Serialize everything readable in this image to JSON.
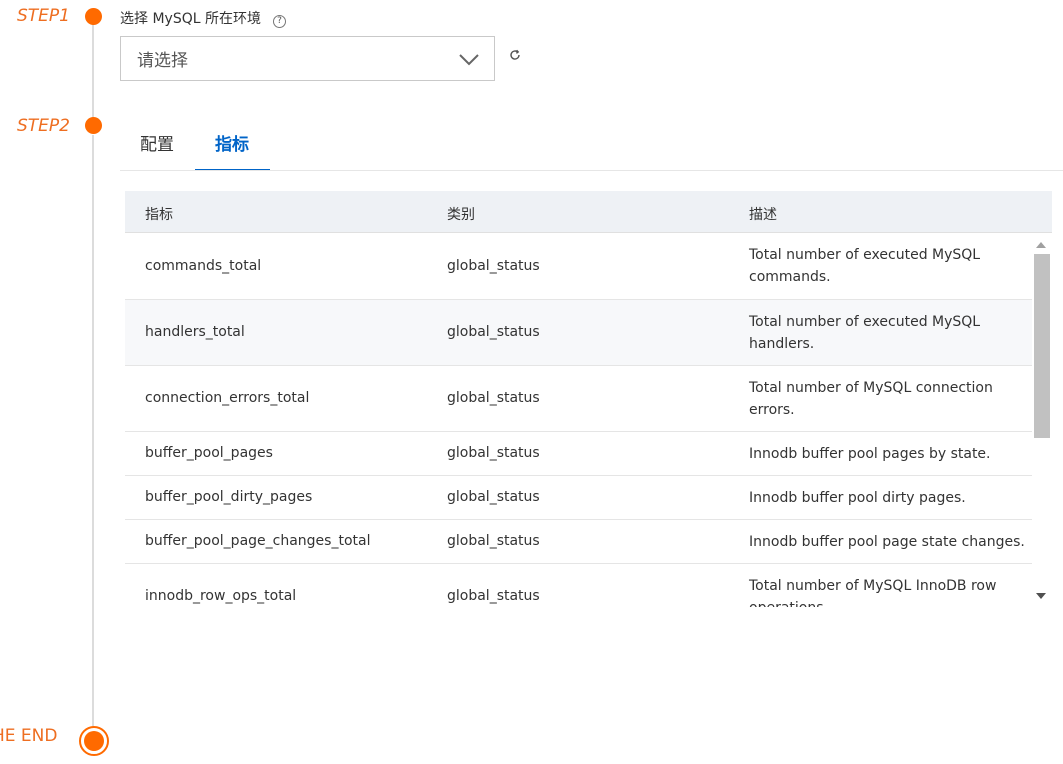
{
  "timeline": {
    "step1_label": "STEP1",
    "step2_label": "STEP2",
    "end_label": "HE END",
    "accent_color": "#ff6a00"
  },
  "step1": {
    "title": "选择 MySQL 所在环境",
    "help_icon": "?",
    "select_placeholder": "请选择"
  },
  "tabs": [
    {
      "label": "配置",
      "active": false
    },
    {
      "label": "指标",
      "active": true
    }
  ],
  "table": {
    "headers": [
      "指标",
      "类别",
      "描述"
    ],
    "rows": [
      {
        "metric": "commands_total",
        "category": "global_status",
        "description": "Total number of executed MySQL commands."
      },
      {
        "metric": "handlers_total",
        "category": "global_status",
        "description": "Total number of executed MySQL handlers."
      },
      {
        "metric": "connection_errors_total",
        "category": "global_status",
        "description": "Total number of MySQL connection errors."
      },
      {
        "metric": "buffer_pool_pages",
        "category": "global_status",
        "description": "Innodb buffer pool pages by state."
      },
      {
        "metric": "buffer_pool_dirty_pages",
        "category": "global_status",
        "description": "Innodb buffer pool dirty pages."
      },
      {
        "metric": "buffer_pool_page_changes_total",
        "category": "global_status",
        "description": "Innodb buffer pool page state changes."
      },
      {
        "metric": "innodb_row_ops_total",
        "category": "global_status",
        "description": "Total number of MySQL InnoDB row operations."
      }
    ]
  }
}
